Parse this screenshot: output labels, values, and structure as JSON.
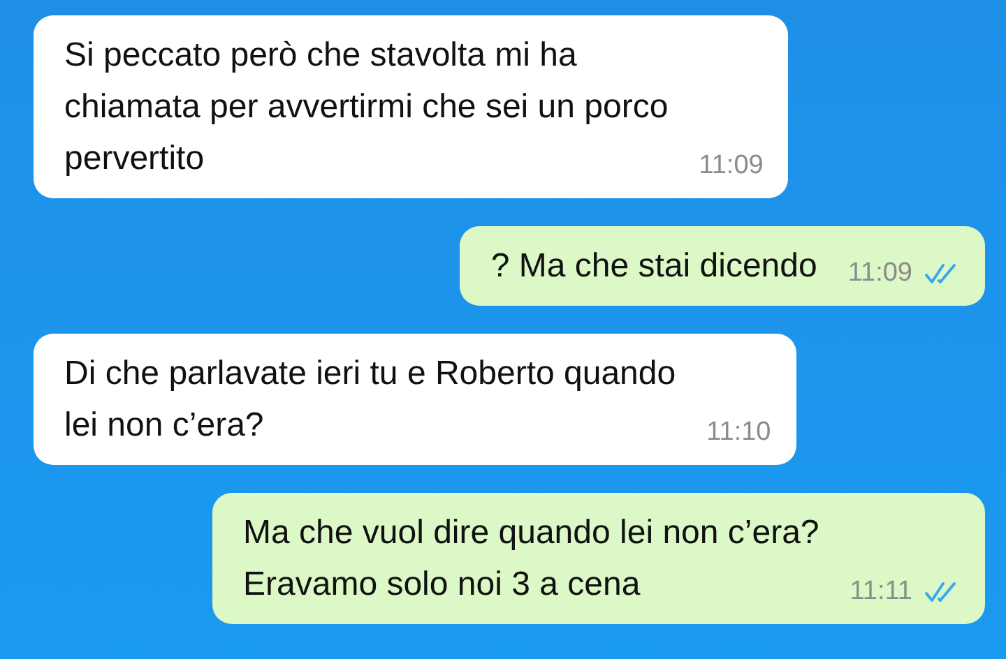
{
  "messages": [
    {
      "kind": "incoming",
      "text": "Si peccato però che stavolta mi ha\nchiamata per avvertirmi che sei un porco\npervertito",
      "time": "11:09"
    },
    {
      "kind": "outgoing",
      "text": "? Ma che stai dicendo",
      "time": "11:09",
      "read": true
    },
    {
      "kind": "incoming",
      "text": "Di che parlavate ieri tu e Roberto quando\nlei non c’era?",
      "time": "11:10"
    },
    {
      "kind": "outgoing",
      "text": "Ma che vuol dire quando lei non c’era?\nEravamo solo noi 3 a cena",
      "time": "11:11",
      "read": true
    }
  ]
}
